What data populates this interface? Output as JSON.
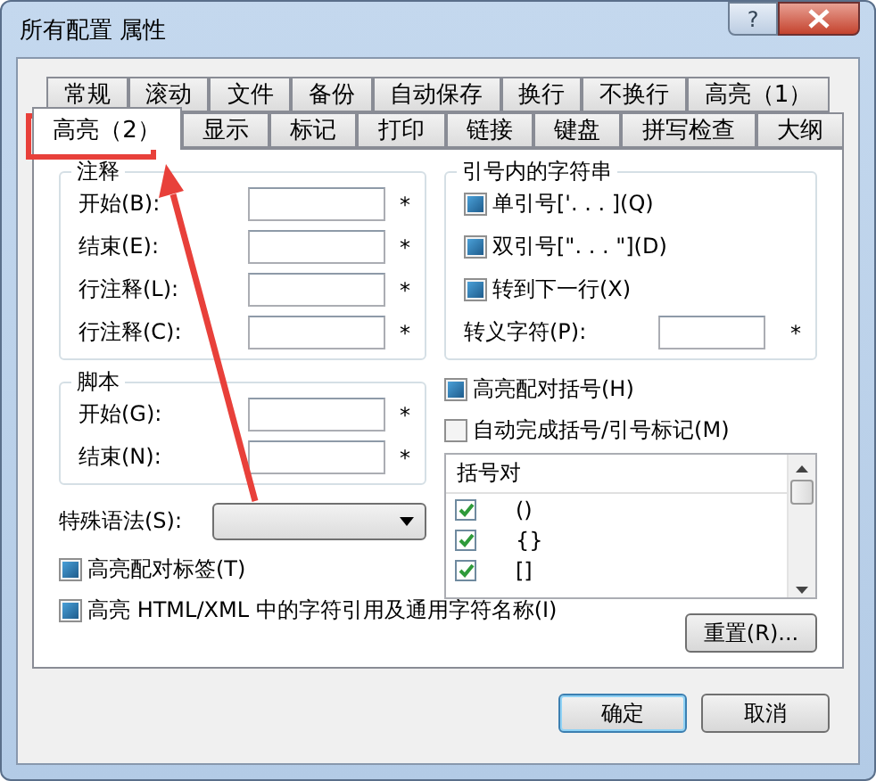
{
  "window": {
    "title": "所有配置 属性",
    "help_button": "?"
  },
  "tabs": [
    [
      {
        "label": "常规",
        "selected": false
      },
      {
        "label": "滚动",
        "selected": false
      },
      {
        "label": "文件",
        "selected": false
      },
      {
        "label": "备份",
        "selected": false
      },
      {
        "label": "自动保存",
        "selected": false
      },
      {
        "label": "换行",
        "selected": false
      },
      {
        "label": "不换行",
        "selected": false
      },
      {
        "label": "高亮（1）",
        "selected": false
      }
    ],
    [
      {
        "label": "高亮（2）",
        "selected": true
      },
      {
        "label": "显示",
        "selected": false
      },
      {
        "label": "标记",
        "selected": false
      },
      {
        "label": "打印",
        "selected": false
      },
      {
        "label": "链接",
        "selected": false
      },
      {
        "label": "键盘",
        "selected": false
      },
      {
        "label": "拼写检查",
        "selected": false
      },
      {
        "label": "大纲",
        "selected": false
      }
    ]
  ],
  "comment_group": {
    "title": "注释",
    "fields": [
      {
        "label": "开始(B):",
        "mark": "*"
      },
      {
        "label": "结束(E):",
        "mark": "*"
      },
      {
        "label": "行注释(L):",
        "mark": "*"
      },
      {
        "label": "行注释(C):",
        "mark": "*"
      }
    ]
  },
  "script_group": {
    "title": "脚本",
    "fields": [
      {
        "label": "开始(G):",
        "mark": "*"
      },
      {
        "label": "结束(N):",
        "mark": "*"
      }
    ]
  },
  "special_syntax": {
    "label": "特殊语法(S):"
  },
  "bottom_options": [
    {
      "label": "高亮配对标签(T)",
      "checked": true
    },
    {
      "label": "高亮 HTML/XML 中的字符引用及通用字符名称(I)",
      "checked": true
    }
  ],
  "quotes_group": {
    "title": "引号内的字符串",
    "options": [
      {
        "label": "单引号['. . . ](Q)",
        "checked": true
      },
      {
        "label": "双引号[\". . . \"](D)",
        "checked": true
      },
      {
        "label": "转到下一行(X)",
        "checked": true
      }
    ],
    "escape_field": {
      "label": "转义字符(P):",
      "mark": "*"
    }
  },
  "right_options": [
    {
      "label": "高亮配对括号(H)",
      "checked": true
    },
    {
      "label": "自动完成括号/引号标记(M)",
      "checked": false
    }
  ],
  "bracket_list": {
    "header": "括号对",
    "rows": [
      {
        "text": "()",
        "checked": true
      },
      {
        "text": "{}",
        "checked": true
      },
      {
        "text": "[]",
        "checked": true
      }
    ]
  },
  "reset_button": "重置(R)...",
  "buttons": [
    "确定",
    "取消"
  ]
}
